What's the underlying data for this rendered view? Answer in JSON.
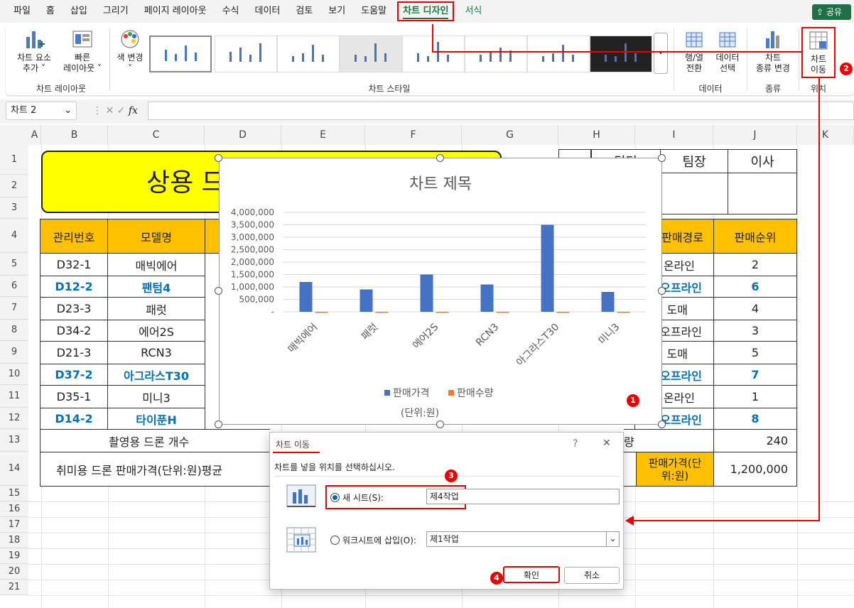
{
  "menubar": {
    "items": [
      "파일",
      "홈",
      "삽입",
      "그리기",
      "페이지 레이아웃",
      "수식",
      "데이터",
      "검토",
      "보기",
      "도움말",
      "차트 디자인",
      "서식"
    ],
    "share": "공유"
  },
  "ribbon": {
    "add_element": [
      "차트 요소",
      "추가 ˅"
    ],
    "quick_layout": [
      "빠른",
      "레이아웃 ˅"
    ],
    "change_colors": [
      "색 변경",
      "˅"
    ],
    "switch_rowcol": [
      "행/열",
      "전환"
    ],
    "select_data": [
      "데이터",
      "선택"
    ],
    "change_type": [
      "차트",
      "종류 변경"
    ],
    "move_chart": [
      "차트",
      "이동"
    ],
    "groups": [
      "차트 레이아웃",
      "차트 스타일",
      "데이터",
      "종류",
      "위치"
    ]
  },
  "formula_bar": {
    "name_box": "차트 2",
    "fx": "fx"
  },
  "columns": [
    "A",
    "B",
    "C",
    "D",
    "E",
    "F",
    "G",
    "H",
    "I",
    "J",
    "K"
  ],
  "rows": [
    "1",
    "2",
    "3",
    "4",
    "5",
    "6",
    "7",
    "8",
    "9",
    "10",
    "11",
    "12",
    "13",
    "14",
    "15",
    "16",
    "17",
    "18",
    "19",
    "20",
    "21"
  ],
  "sheet": {
    "title": "상용 드",
    "approval": [
      "담당",
      "팀장",
      "이사"
    ],
    "headers": {
      "id": "관리번호",
      "model": "모델명",
      "channel": "판매경로",
      "rank": "판매순위"
    },
    "rows": [
      {
        "id": "D32-1",
        "model": "매빅에어",
        "channel": "온라인",
        "rank": "2"
      },
      {
        "id": "D12-2",
        "model": "팬텀4",
        "channel": "오프라인",
        "rank": "6"
      },
      {
        "id": "D23-3",
        "model": "패럿",
        "channel": "도매",
        "rank": "4"
      },
      {
        "id": "D34-2",
        "model": "에어2S",
        "channel": "오프라인",
        "rank": "3"
      },
      {
        "id": "D21-3",
        "model": "RCN3",
        "channel": "도매",
        "rank": "5"
      },
      {
        "id": "D37-2",
        "model": "아그라스T30",
        "channel": "오프라인",
        "rank": "7"
      },
      {
        "id": "D35-1",
        "model": "미니3",
        "channel": "온라인",
        "rank": "1"
      },
      {
        "id": "D14-2",
        "model": "타이푼H",
        "channel": "오프라인",
        "rank": "8"
      }
    ],
    "r13_label": "촬영용 드론 개수",
    "r13_mid": "량",
    "r13_value": "240",
    "r14_label": "취미용 드론 판매가격(단위:원)평균",
    "r14_hdr": "판매가격(단위:원)",
    "r14_value": "1,200,000"
  },
  "chart_data": {
    "type": "bar",
    "title": "차트 제목",
    "categories": [
      "매빅에어",
      "패럿",
      "에어2S",
      "RCN3",
      "아그라스T30",
      "미니3"
    ],
    "series": [
      {
        "name": "판매가격",
        "values": [
          1200000,
          900000,
          1500000,
          1100000,
          3500000,
          800000
        ],
        "color": "#4472c4"
      },
      {
        "name": "판매수량",
        "values": [
          20,
          15,
          25,
          18,
          30,
          22
        ],
        "color": "#ed7d31"
      }
    ],
    "yticks": [
      "4,000,000",
      "3,500,000",
      "3,000,000",
      "2,500,000",
      "2,000,000",
      "1,500,000",
      "1,000,000",
      "500,000",
      "-"
    ],
    "ylim": [
      0,
      4000000
    ],
    "annotation": "(단위:원)",
    "legend": "bottom"
  },
  "dialog": {
    "title": "차트 이동",
    "help": "?",
    "close": "✕",
    "prompt": "차트를 넣을 위치를 선택하십시오.",
    "new_sheet_label": "새 시트(S):",
    "new_sheet_value": "제4작업",
    "object_label": "워크시트에 삽입(O):",
    "object_value": "제1작업",
    "ok": "확인",
    "cancel": "취소"
  },
  "badges": [
    "1",
    "2",
    "3",
    "4"
  ]
}
